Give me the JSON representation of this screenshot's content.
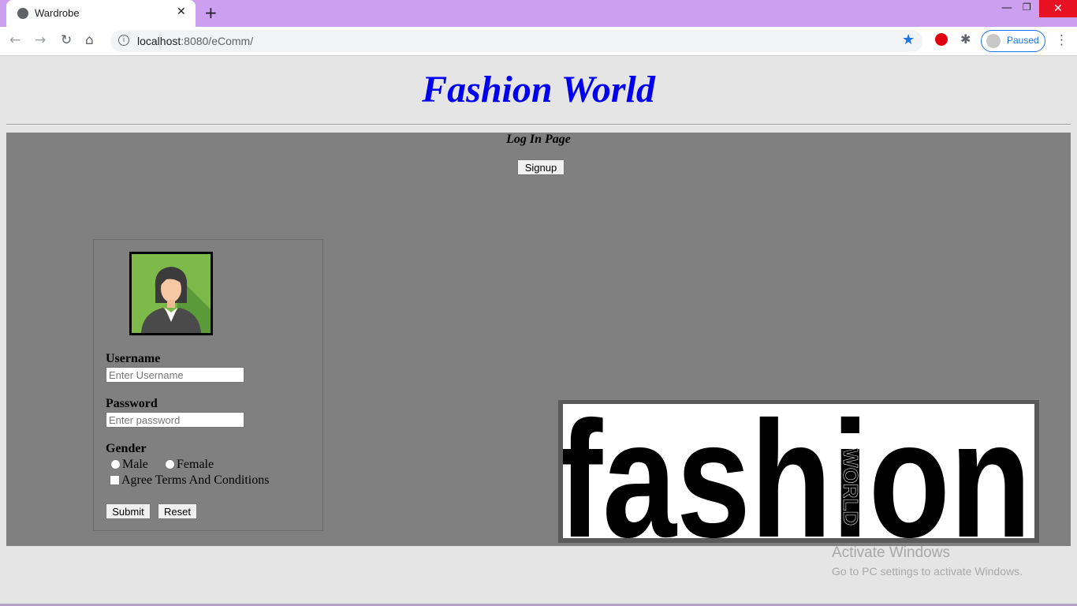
{
  "browser": {
    "tab_title": "Wardrobe",
    "tab_close": "✕",
    "new_tab": "+",
    "url_host": "localhost",
    "url_rest": ":8080/eComm/",
    "profile_status": "Paused",
    "icons": [
      "globe-icon",
      "back-icon",
      "forward-icon",
      "reload-icon",
      "home-icon",
      "info-icon",
      "star-icon",
      "opera-icon",
      "puzzle-icon",
      "menu-icon"
    ]
  },
  "page": {
    "site_title": "Fashion World",
    "page_label": "Log In Page",
    "signup_label": "Signup"
  },
  "form": {
    "username_label": "Username",
    "username_placeholder": "Enter Username",
    "password_label": "Password",
    "password_placeholder": "Enter password",
    "gender_label": "Gender",
    "gender_options": [
      "Male",
      "Female"
    ],
    "terms_label": "Agree Terms And Conditions",
    "submit_label": "Submit",
    "reset_label": "Reset"
  },
  "logo": {
    "text": "fashion",
    "sub_text": "WORLD"
  },
  "watermark": {
    "line1": "Activate Windows",
    "line2": "Go to PC settings to activate Windows."
  },
  "colors": {
    "tabbar": "#cca0ee",
    "title": "#0000ee",
    "panel": "#808080",
    "page_bg": "#e5e5e5"
  }
}
